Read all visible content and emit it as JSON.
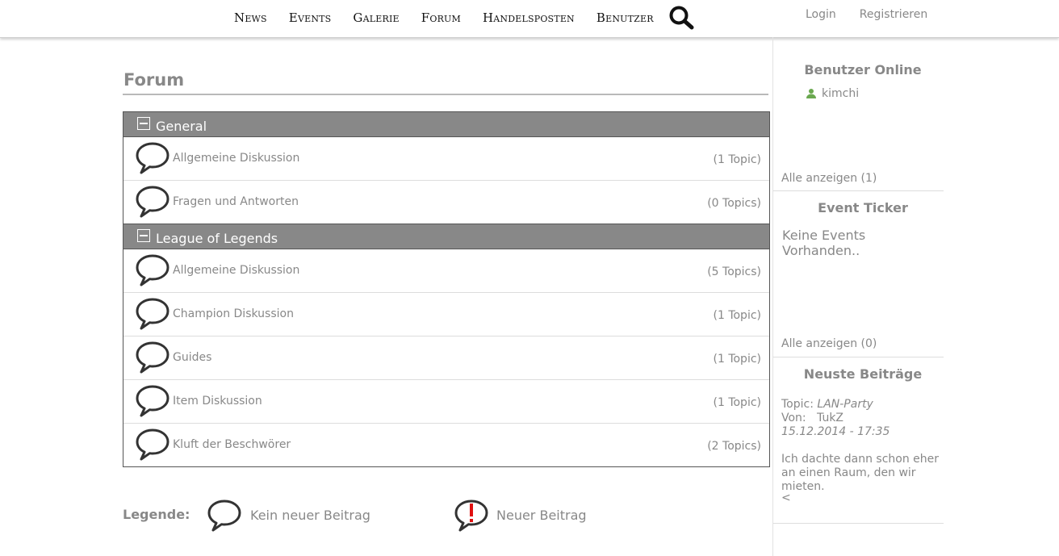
{
  "nav": {
    "items": [
      "News",
      "Events",
      "Galerie",
      "Forum",
      "Handelsposten",
      "Benutzer"
    ],
    "login": "Login",
    "register": "Registrieren"
  },
  "main": {
    "title": "Forum",
    "categories": [
      {
        "title": "General",
        "boards": [
          {
            "name": "Allgemeine Diskussion",
            "count": "(1 Topic)"
          },
          {
            "name": "Fragen und Antworten",
            "count": "(0 Topics)"
          }
        ]
      },
      {
        "title": "League of Legends",
        "boards": [
          {
            "name": "Allgemeine Diskussion",
            "count": "(5 Topics)"
          },
          {
            "name": "Champion Diskussion",
            "count": "(1 Topic)"
          },
          {
            "name": "Guides",
            "count": "(1 Topic)"
          },
          {
            "name": "Item Diskussion",
            "count": "(1 Topic)"
          },
          {
            "name": "Kluft der Beschwörer",
            "count": "(2 Topics)"
          }
        ]
      }
    ],
    "legend": {
      "title": "Legende:",
      "no_new": "Kein neuer Beitrag",
      "new": "Neuer Beitrag"
    }
  },
  "sidebar": {
    "online": {
      "title": "Benutzer Online",
      "users": [
        "kimchi"
      ],
      "show_all": "Alle anzeigen (1)"
    },
    "ticker": {
      "title": "Event Ticker",
      "empty_text": "Keine Events Vorhanden..",
      "show_all": "Alle anzeigen (0)"
    },
    "latest": {
      "title": "Neuste Beiträge",
      "topic_label": "Topic:",
      "topic": "LAN-Party",
      "from_label": "Von:",
      "author": "TukZ",
      "date": "15.12.2014 - 17:35",
      "excerpt": "Ich dachte dann schon eher an einen Raum, den wir mieten.",
      "more": "<"
    }
  },
  "colors": {
    "category_bg": "#888888",
    "text": "#888888",
    "nav_text": "#111111",
    "alert": "#e01010"
  }
}
